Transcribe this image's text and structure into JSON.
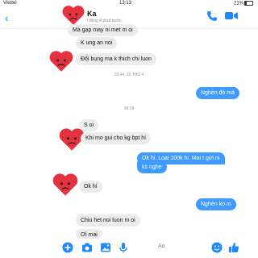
{
  "status": {
    "carrier": "Viettel",
    "time": "13:13",
    "battery": "21%"
  },
  "header": {
    "name": "Ka",
    "subtitle": "t động 8 phút trước",
    "back_glyph": "‹"
  },
  "messages": [
    {
      "text": "Mà gạp may ni met m oi"
    },
    {
      "text": "K ung an noi"
    },
    {
      "text": "Đối bụng ma k thich chi luon"
    },
    {
      "text": "19:44, 25 THG 4"
    },
    {
      "text": "Nghèn đó mà"
    },
    {
      "text": "08:38"
    },
    {
      "text": "S oi"
    },
    {
      "text": "Khi mo gui cho kg bpt hí"
    },
    {
      "text": "Ok hi. Loai 100k hi. Mai t gửi ni"
    },
    {
      "text": "ks nghe"
    },
    {
      "text": "Ok hí"
    },
    {
      "text": "Nghèn ko m"
    },
    {
      "text": "Chiu het noi luon m oi"
    },
    {
      "text": "Ơi mai"
    }
  ],
  "composer": {
    "aa_label": "Aa"
  },
  "colors": {
    "accent": "#3f9bff",
    "heart": "#e4333f",
    "received_bubble": "#ececec"
  },
  "icons": [
    "back-chevron-icon",
    "heart-sticker-icon",
    "phone-icon",
    "video-camera-icon",
    "plus-circle-icon",
    "camera-icon",
    "image-icon",
    "microphone-icon",
    "emoji-icon",
    "thumbs-up-icon"
  ]
}
